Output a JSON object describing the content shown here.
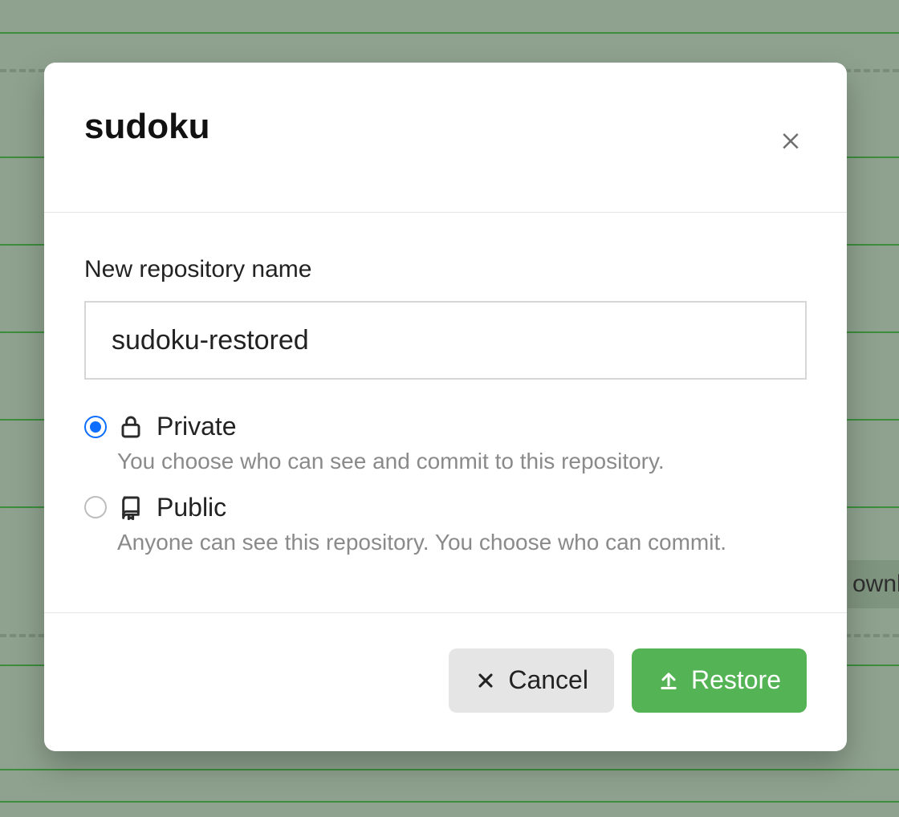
{
  "background": {
    "chip_text": "ownl"
  },
  "modal": {
    "title": "sudoku",
    "field_label": "New repository name",
    "repo_name_value": "sudoku-restored",
    "visibility": {
      "private": {
        "label": "Private",
        "description": "You choose who can see and commit to this repository.",
        "selected": true
      },
      "public": {
        "label": "Public",
        "description": "Anyone can see this repository. You choose who can commit.",
        "selected": false
      }
    },
    "buttons": {
      "cancel": "Cancel",
      "restore": "Restore"
    }
  }
}
